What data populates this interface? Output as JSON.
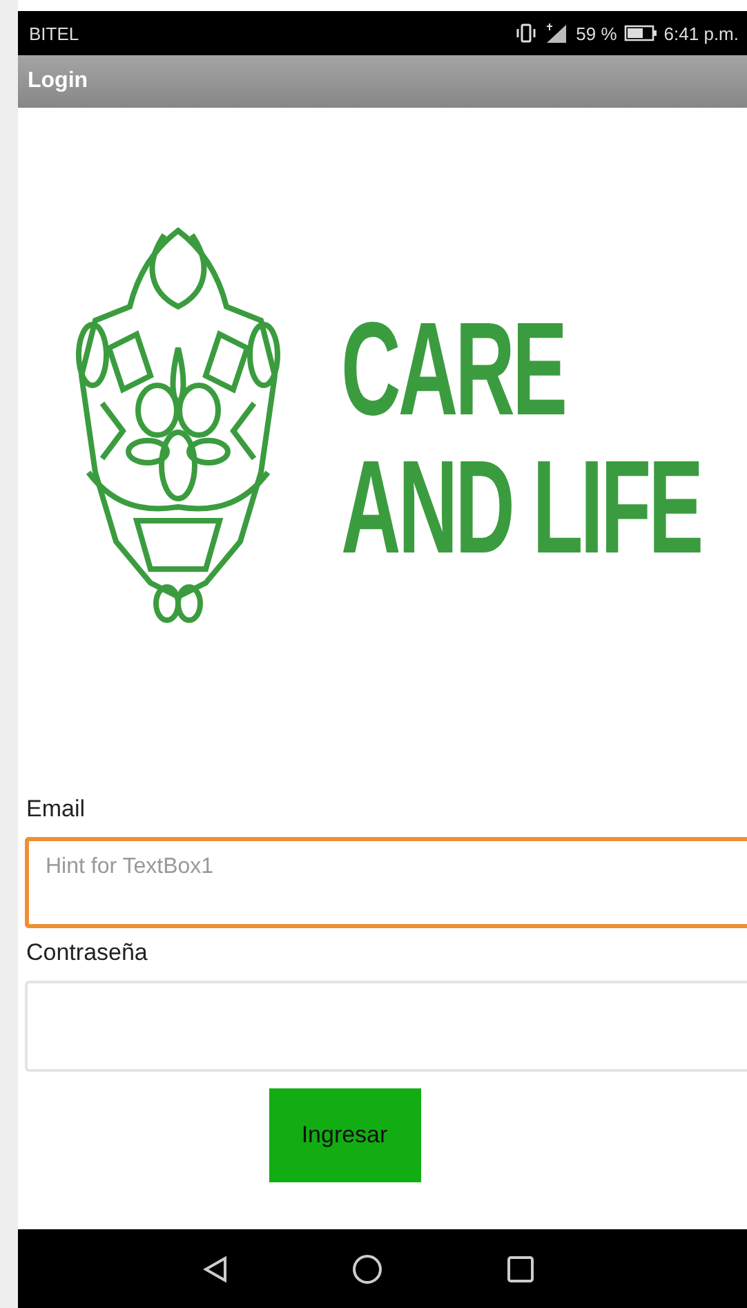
{
  "status_bar": {
    "carrier": "BITEL",
    "battery": "59 %",
    "time": "6:41 p.m."
  },
  "title_bar": {
    "title": "Login"
  },
  "logo": {
    "lines": [
      "CARE",
      "AND LIFE"
    ]
  },
  "form": {
    "fields": [
      {
        "label": "Email",
        "placeholder": "Hint for TextBox1",
        "focused": true
      },
      {
        "label": "Contraseña",
        "focused": false
      }
    ],
    "submit": "Ingresar"
  }
}
